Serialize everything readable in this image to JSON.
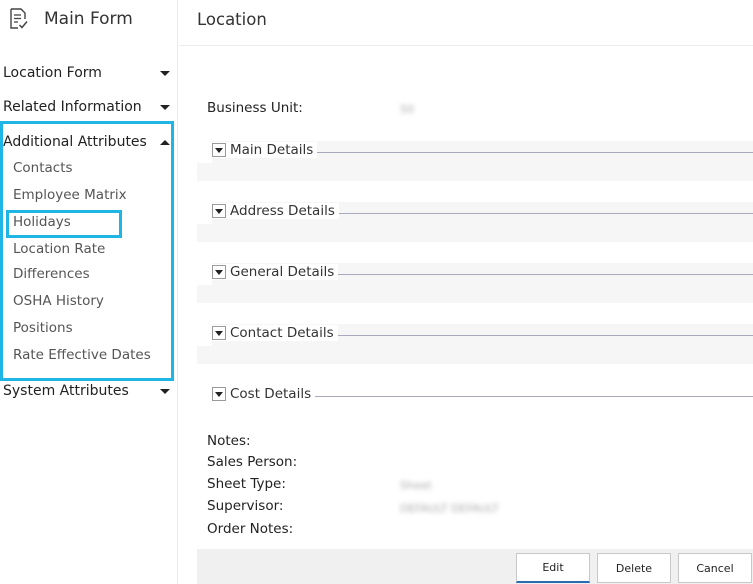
{
  "sidebar": {
    "title": "Main Form",
    "sections": [
      {
        "label": "Location Form",
        "expanded": false
      },
      {
        "label": "Related Information",
        "expanded": false
      },
      {
        "label": "Additional Attributes",
        "expanded": true
      },
      {
        "label": "System Attributes",
        "expanded": false
      }
    ],
    "sub_items": [
      "Contacts",
      "Employee Matrix",
      "Holidays",
      "Location Rate",
      "Differences",
      "OSHA History",
      "Positions",
      "Rate Effective Dates"
    ],
    "highlight_color": "#1fb6e6"
  },
  "main": {
    "page_title": "Location",
    "business_unit_label": "Business Unit:",
    "business_unit_value": "50",
    "sections": [
      "Main Details",
      "Address Details",
      "General Details",
      "Contact Details",
      "Cost Details"
    ],
    "fields": {
      "notes": "Notes:",
      "sales_person": "Sales Person:",
      "sheet_type": "Sheet Type:",
      "sheet_type_value": "Sheet",
      "supervisor": "Supervisor:",
      "supervisor_value": "DEFAULT DEFAULT",
      "order_notes": "Order Notes:"
    },
    "buttons": {
      "edit": "Edit",
      "delete": "Delete",
      "cancel": "Cancel"
    }
  }
}
